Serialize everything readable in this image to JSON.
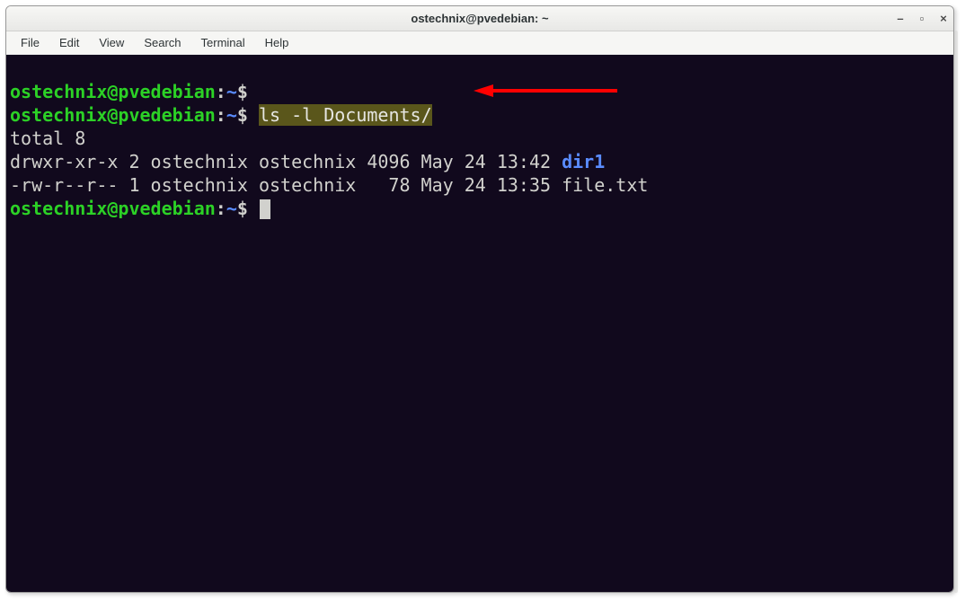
{
  "titlebar": {
    "title": "ostechnix@pvedebian: ~",
    "controls": {
      "min": "–",
      "max": "▫",
      "close": "×"
    }
  },
  "menubar": {
    "items": [
      "File",
      "Edit",
      "View",
      "Search",
      "Terminal",
      "Help"
    ]
  },
  "prompt": {
    "user_host": "ostechnix@pvedebian",
    "colon": ":",
    "path": "~",
    "dollar": "$"
  },
  "lines": {
    "cmd1": " ",
    "cmd2_hl": "ls -l Documents/",
    "out_total": "total 8",
    "out_row1a": "drwxr-xr-x 2 ostechnix ostechnix 4096 May 24 13:42 ",
    "out_row1_dir": "dir1",
    "out_row2": "-rw-r--r-- 1 ostechnix ostechnix   78 May 24 13:35 file.txt"
  },
  "arrow": {
    "color": "#ff0000"
  }
}
